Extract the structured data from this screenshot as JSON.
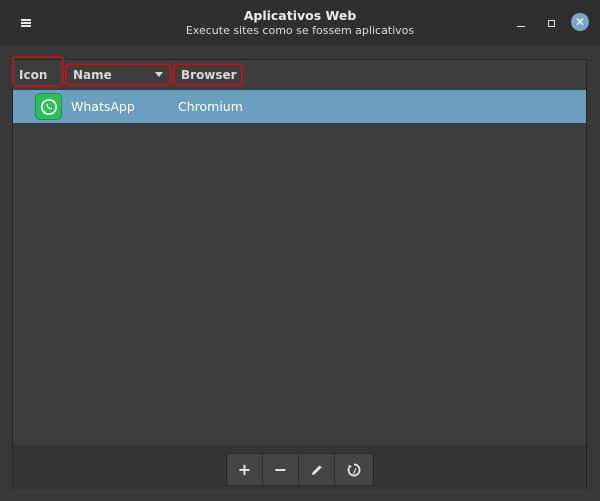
{
  "window": {
    "title": "Aplicativos Web",
    "subtitle": "Execute sites como se fossem aplicativos"
  },
  "columns": {
    "icon": "Icon",
    "name": "Name",
    "browser": "Browser"
  },
  "rows": [
    {
      "name": "WhatsApp",
      "browser": "Chromium",
      "icon": "whatsapp-icon",
      "selected": true
    }
  ],
  "toolbar": {
    "add": "+",
    "remove": "−"
  },
  "colors": {
    "selection": "#6a9fbf",
    "highlight": "#b8141c",
    "whatsapp": "#2fbf5a",
    "close": "#7ba6c6"
  }
}
